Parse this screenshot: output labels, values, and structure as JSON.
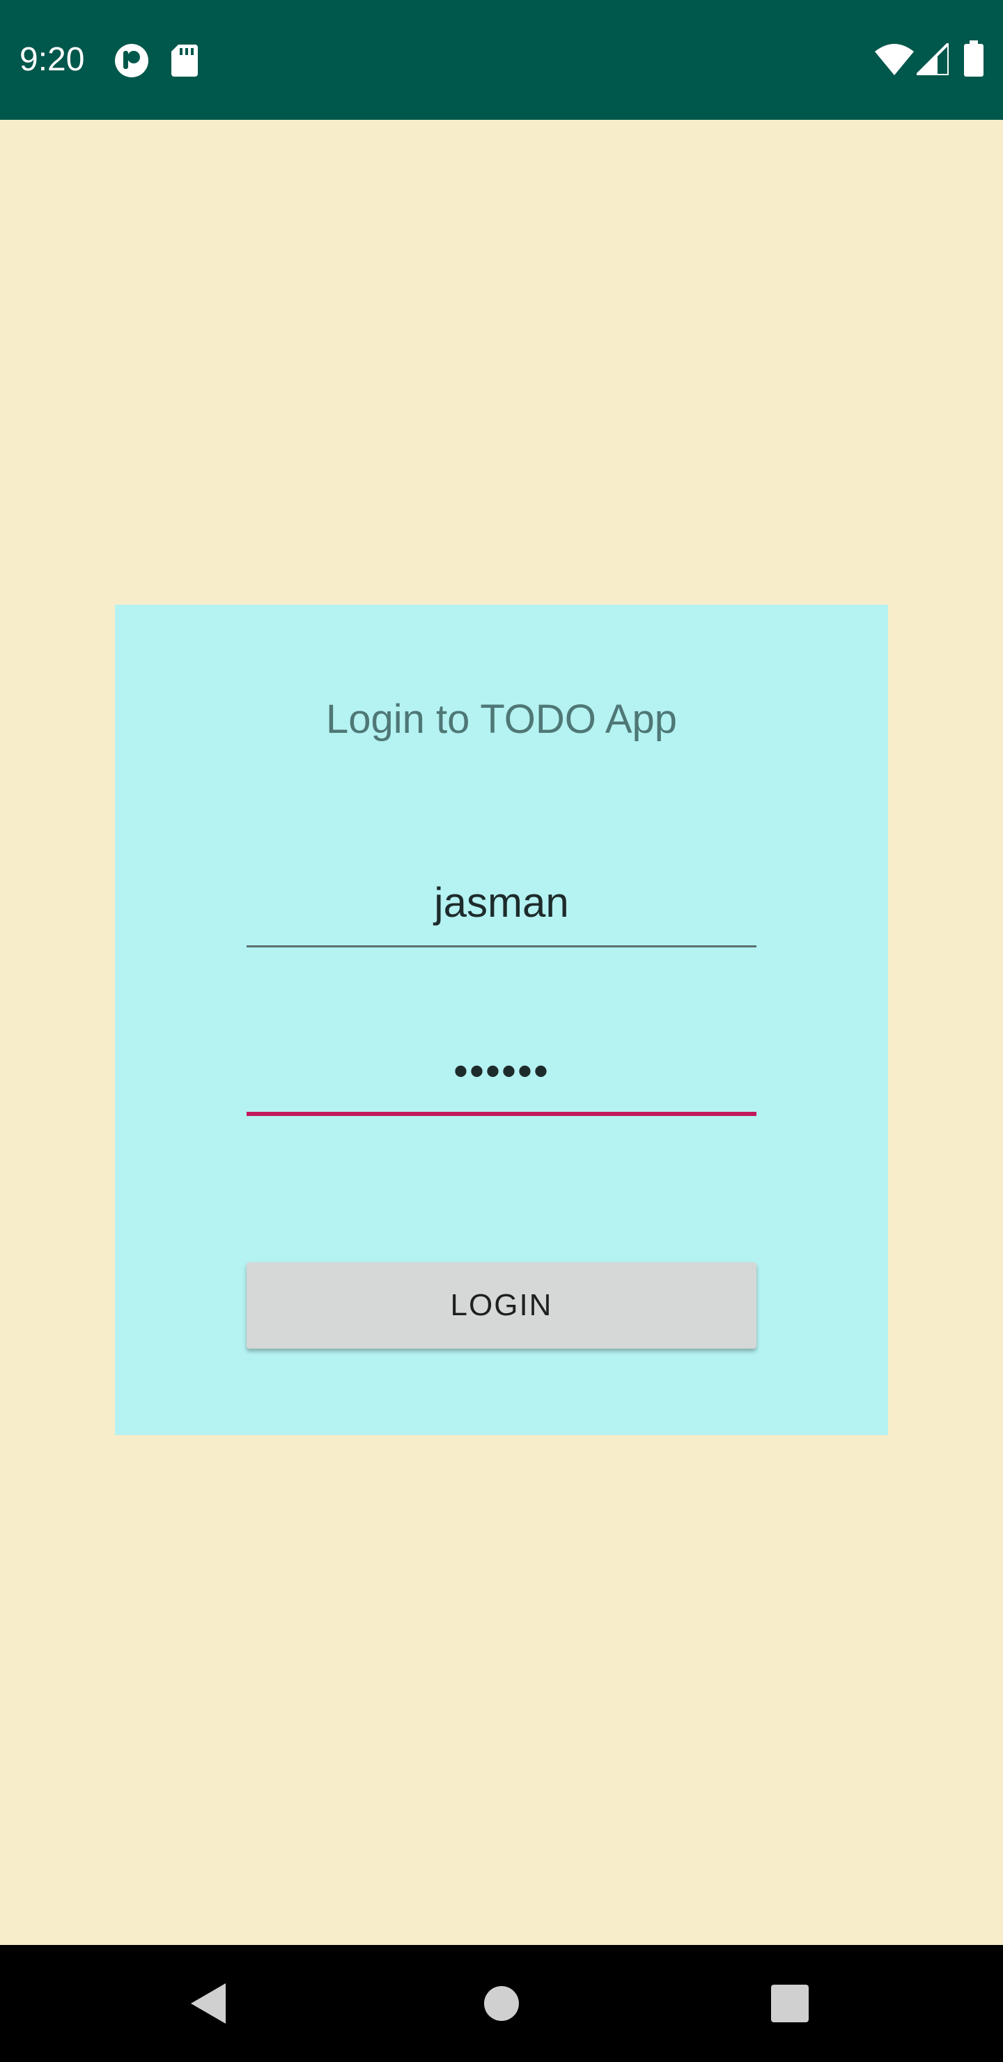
{
  "status_bar": {
    "time": "9:20",
    "left_icons": [
      "app-notification-icon",
      "sd-card-icon"
    ],
    "right_icons": [
      "wifi-icon",
      "cellular-signal-icon",
      "battery-icon"
    ],
    "color": "#00574b"
  },
  "login_card": {
    "title": "Login to TODO App",
    "username": {
      "value": "jasman"
    },
    "password": {
      "value": "••••••"
    },
    "login_button_label": "LOGIN",
    "background": "#b5f2f2",
    "accent": "#c2185b"
  },
  "nav_bar": {
    "buttons": [
      "back-icon",
      "home-icon",
      "recents-icon"
    ]
  },
  "page_background": "#f7edcb"
}
